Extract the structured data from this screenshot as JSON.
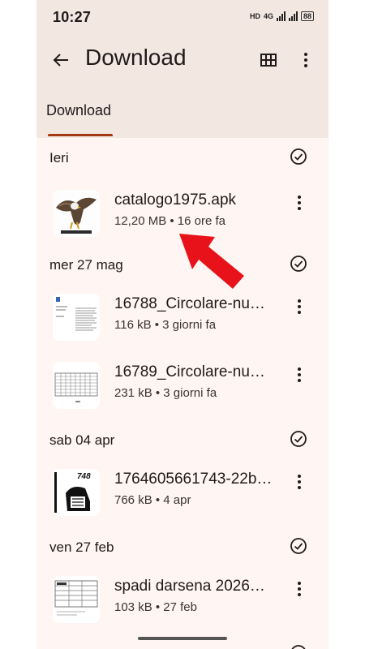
{
  "status": {
    "time": "10:27",
    "hd": "HD",
    "network": "4G",
    "battery": "88"
  },
  "header": {
    "title": "Download",
    "tab": "Download"
  },
  "sections": [
    {
      "label": "Ieri",
      "items": [
        {
          "name": "catalogo1975.apk",
          "meta": "12,20 MB • 16 ore fa"
        }
      ]
    },
    {
      "label": "mer 27 mag",
      "items": [
        {
          "name": "16788_Circolare-nu…",
          "meta": "116 kB • 3 giorni fa"
        },
        {
          "name": "16789_Circolare-nu…",
          "meta": "231 kB • 3 giorni fa"
        }
      ]
    },
    {
      "label": "sab 04 apr",
      "items": [
        {
          "name": "1764605661743-22b…",
          "meta": "766 kB • 4 apr",
          "thumb_text": "748"
        }
      ]
    },
    {
      "label": "ven 27 feb",
      "items": [
        {
          "name": "spadi darsena 2026…",
          "meta": "103 kB • 27 feb"
        }
      ]
    }
  ],
  "colors": {
    "accent": "#a23b14",
    "annotation_arrow": "#e8121b"
  }
}
